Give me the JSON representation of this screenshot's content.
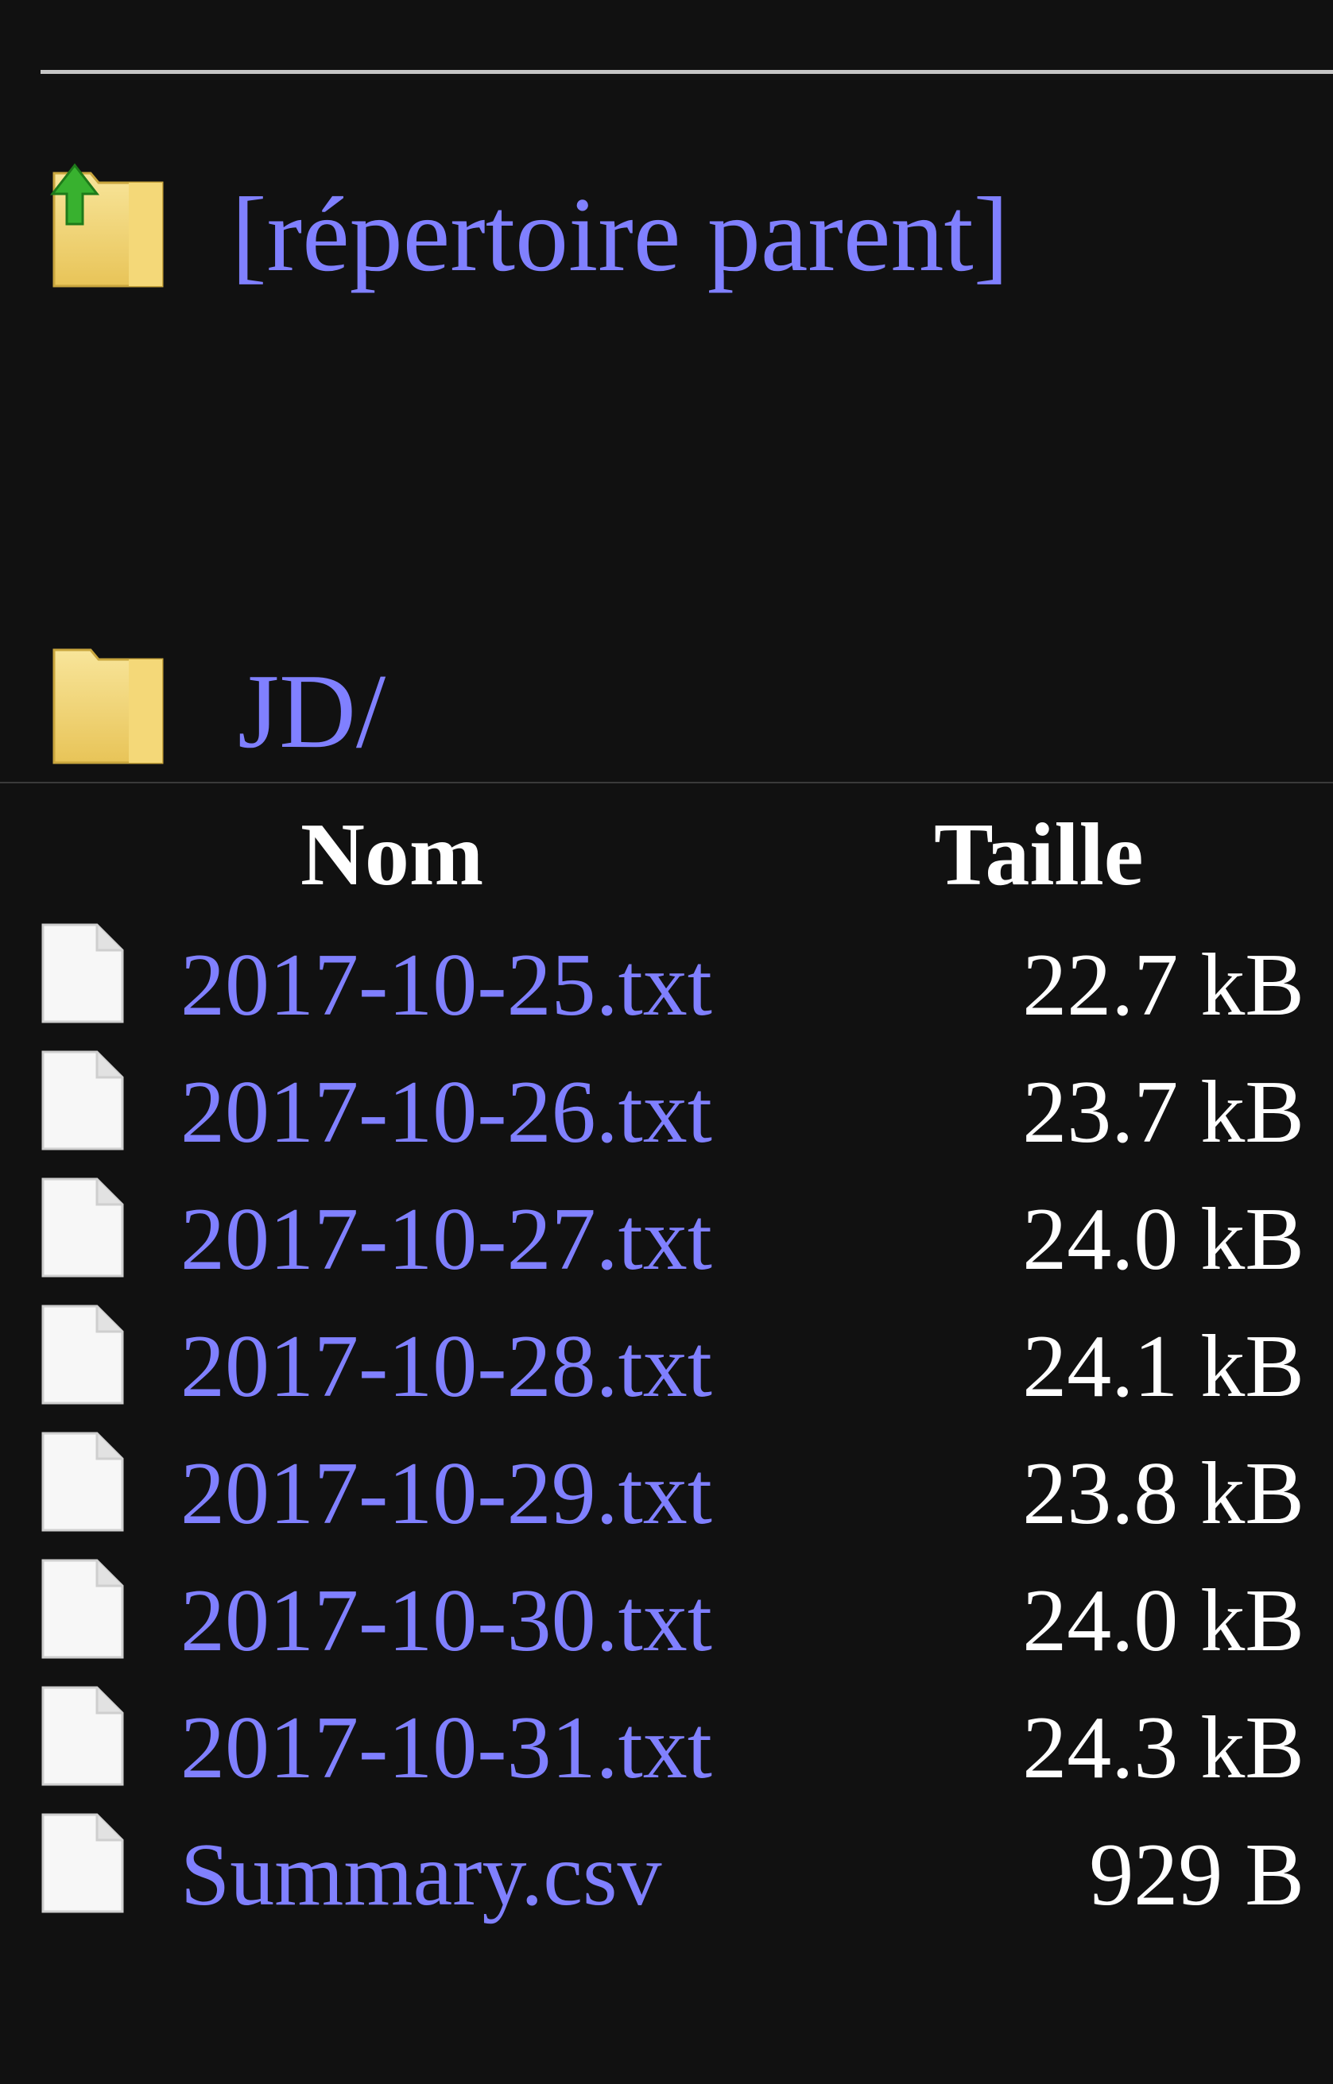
{
  "parent_link": {
    "label": "[répertoire parent]",
    "icon": "folder-up-icon"
  },
  "directory": {
    "label": "JD/",
    "icon": "folder-icon"
  },
  "table": {
    "headers": {
      "name": "Nom",
      "size": "Taille"
    },
    "rows": [
      {
        "name": "2017-10-25.txt",
        "size": "22.7 kB",
        "icon": "file-icon"
      },
      {
        "name": "2017-10-26.txt",
        "size": "23.7 kB",
        "icon": "file-icon"
      },
      {
        "name": "2017-10-27.txt",
        "size": "24.0 kB",
        "icon": "file-icon"
      },
      {
        "name": "2017-10-28.txt",
        "size": "24.1 kB",
        "icon": "file-icon"
      },
      {
        "name": "2017-10-29.txt",
        "size": "23.8 kB",
        "icon": "file-icon"
      },
      {
        "name": "2017-10-30.txt",
        "size": "24.0 kB",
        "icon": "file-icon"
      },
      {
        "name": "2017-10-31.txt",
        "size": "24.3 kB",
        "icon": "file-icon"
      },
      {
        "name": "Summary.csv",
        "size": "929 B",
        "icon": "file-icon"
      }
    ]
  },
  "colors": {
    "background": "#111111",
    "link": "#8080ff",
    "text": "#ffffff",
    "folder": "#f2d16b",
    "arrow": "#3fb53a"
  }
}
